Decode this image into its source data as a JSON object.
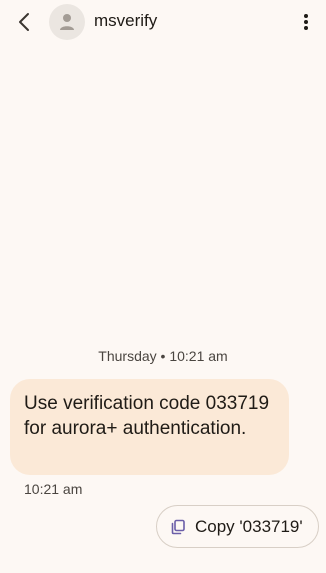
{
  "header": {
    "contact_name": "msverify"
  },
  "conversation": {
    "date_divider": "Thursday • 10:21 am",
    "messages": [
      {
        "text": "Use verification code 033719 for aurora+ authentication.",
        "time": "10:21 am"
      }
    ]
  },
  "suggestions": {
    "copy_label": "Copy '033719'"
  },
  "icons": {
    "back": "arrow-back-icon",
    "avatar": "person-icon",
    "menu": "more-vert-icon",
    "copy": "copy-icon"
  },
  "colors": {
    "background": "#fdf8f4",
    "bubble": "#fbe9d7",
    "copy_icon": "#6b5ea8"
  }
}
